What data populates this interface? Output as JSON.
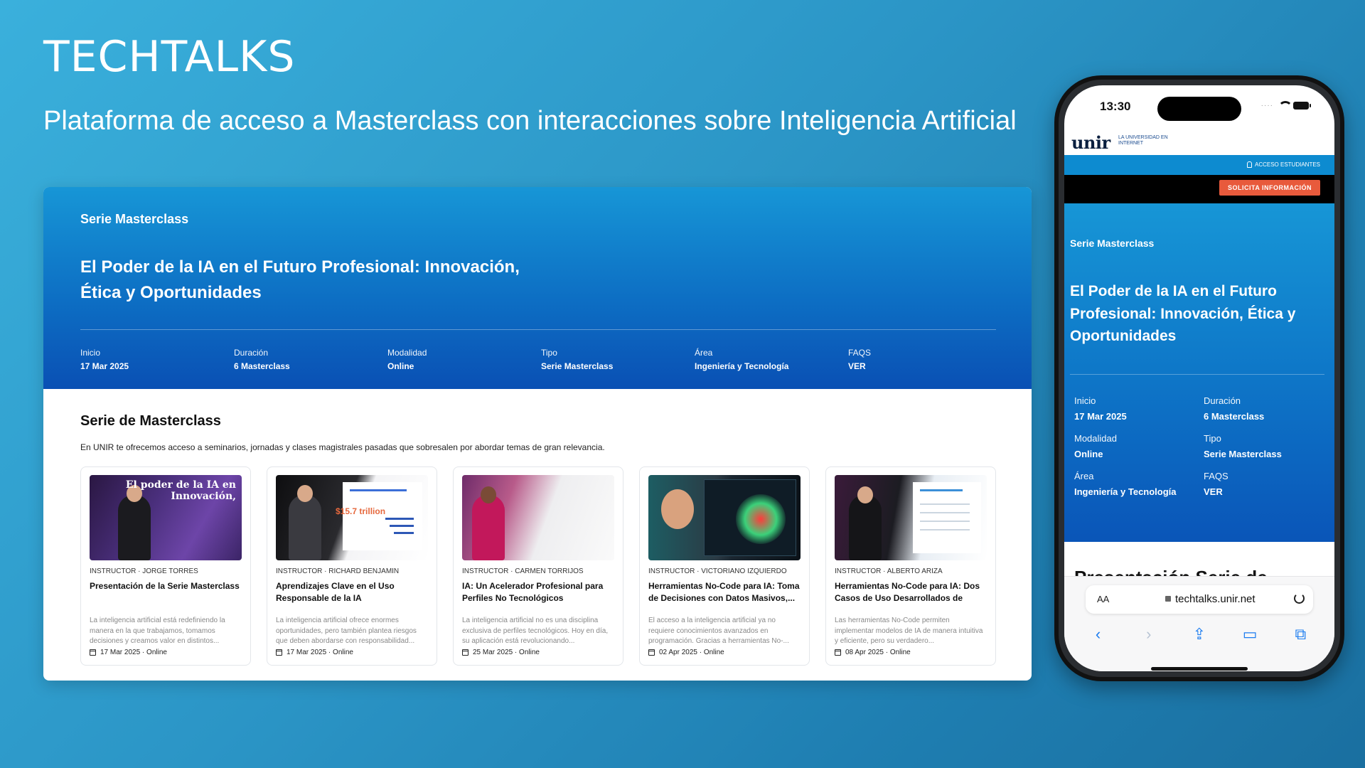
{
  "brand": {
    "title": "TECHTALKS",
    "subtitle": "Plataforma de acceso a Masterclass con interacciones sobre Inteligencia Artificial"
  },
  "desktop": {
    "hero": {
      "series_label": "Serie Masterclass",
      "title": "El Poder de la IA en el Futuro Profesional: Innovación, Ética y Oportunidades",
      "meta": [
        {
          "key": "Inicio",
          "value": "17 Mar 2025"
        },
        {
          "key": "Duración",
          "value": "6 Masterclass"
        },
        {
          "key": "Modalidad",
          "value": "Online"
        },
        {
          "key": "Tipo",
          "value": "Serie Masterclass"
        },
        {
          "key": "Área",
          "value": "Ingeniería y Tecnología"
        },
        {
          "key": "FAQS",
          "value": "VER"
        }
      ]
    },
    "section": {
      "heading": "Serie de Masterclass",
      "description": "En UNIR te ofrecemos acceso a seminarios, jornadas y clases magistrales pasadas que sobresalen por abordar temas de gran relevancia."
    },
    "cards": [
      {
        "instructor": "INSTRUCTOR · JORGE TORRES",
        "title": "Presentación de la Serie Masterclass",
        "description": "La inteligencia artificial está redefiniendo la manera en la que trabajamos, tomamos decisiones y creamos valor en distintos...",
        "footer": "17 Mar 2025 · Online",
        "thumb_caption": "El poder de la IA en Innovación,"
      },
      {
        "instructor": "INSTRUCTOR · RICHARD BENJAMIN",
        "title": "Aprendizajes Clave en el Uso Responsable de la IA",
        "description": "La inteligencia artificial ofrece enormes oportunidades, pero también plantea riesgos que deben abordarse con responsabilidad...",
        "footer": "17 Mar 2025 · Online",
        "thumb_caption": "$15.7 trillion"
      },
      {
        "instructor": "INSTRUCTOR · CARMEN TORRIJOS",
        "title": "IA: Un Acelerador Profesional para Perfiles No Tecnológicos",
        "description": "La inteligencia artificial no es una disciplina exclusiva de perfiles tecnológicos. Hoy en día, su aplicación está revolucionando...",
        "footer": "25 Mar 2025 · Online",
        "thumb_caption": ""
      },
      {
        "instructor": "INSTRUCTOR · VICTORIANO IZQUIERDO",
        "title": "Herramientas No-Code para IA: Toma de Decisiones con Datos Masivos,...",
        "description": "El acceso a la inteligencia artificial ya no requiere conocimientos avanzados en programación. Gracias a herramientas No-...",
        "footer": "02 Apr 2025 · Online",
        "thumb_caption": ""
      },
      {
        "instructor": "INSTRUCTOR · ALBERTO ARIZA",
        "title": "Herramientas No-Code para IA: Dos Casos de Uso Desarrollados de Form...",
        "description": "Las herramientas No-Code permiten implementar modelos de IA de manera intuitiva y eficiente, pero su verdadero...",
        "footer": "08 Apr 2025 · Online",
        "thumb_caption": ""
      }
    ]
  },
  "phone": {
    "status": {
      "time": "13:30"
    },
    "header": {
      "logo": "unir",
      "tagline": "LA UNIVERSIDAD EN INTERNET",
      "access": "ACCESO ESTUDIANTES",
      "cta": "SOLICITA INFORMACIÓN"
    },
    "hero": {
      "series_label": "Serie Masterclass",
      "title": "El Poder de la IA en el Futuro Profesional: Innovación, Ética y Oportunidades",
      "meta": [
        {
          "key": "Inicio",
          "value": "17 Mar 2025"
        },
        {
          "key": "Duración",
          "value": "6 Masterclass"
        },
        {
          "key": "Modalidad",
          "value": "Online"
        },
        {
          "key": "Tipo",
          "value": "Serie Masterclass"
        },
        {
          "key": "Área",
          "value": "Ingeniería y Tecnología"
        },
        {
          "key": "FAQS",
          "value": "VER"
        }
      ]
    },
    "section_heading": "Presentación Serie de",
    "browser": {
      "text_size": "AA",
      "url": "techtalks.unir.net",
      "nav": [
        "back-icon",
        "forward-icon",
        "share-icon",
        "bookmarks-icon",
        "tabs-icon"
      ]
    }
  }
}
